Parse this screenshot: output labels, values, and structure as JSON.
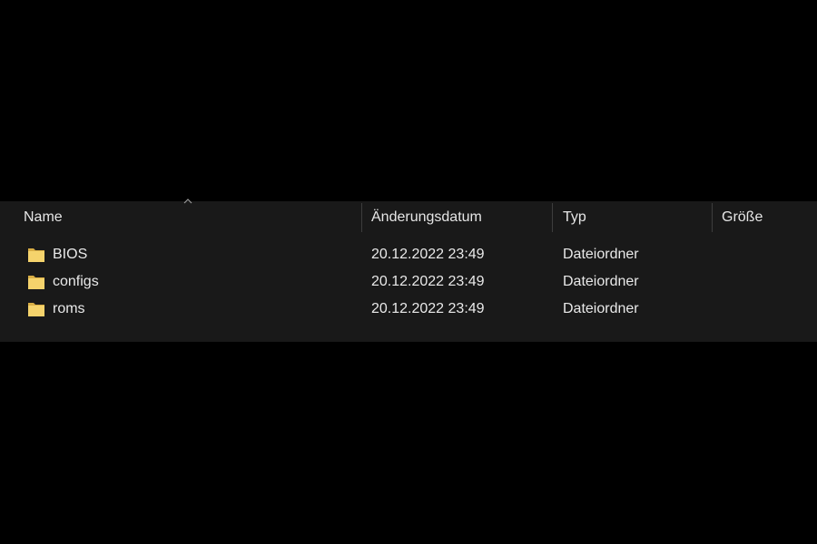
{
  "columns": {
    "name": "Name",
    "modified": "Änderungsdatum",
    "type": "Typ",
    "size": "Größe"
  },
  "sort": {
    "column": "name",
    "indicator": "caret-up-icon"
  },
  "items": [
    {
      "name": "BIOS",
      "modified": "20.12.2022 23:49",
      "type": "Dateiordner",
      "size": "",
      "icon": "folder-icon"
    },
    {
      "name": "configs",
      "modified": "20.12.2022 23:49",
      "type": "Dateiordner",
      "size": "",
      "icon": "folder-icon"
    },
    {
      "name": "roms",
      "modified": "20.12.2022 23:49",
      "type": "Dateiordner",
      "size": "",
      "icon": "folder-icon"
    }
  ],
  "colors": {
    "background": "#000000",
    "panel": "#191919",
    "text": "#e9e9e9",
    "folder": "#f5d36c"
  }
}
